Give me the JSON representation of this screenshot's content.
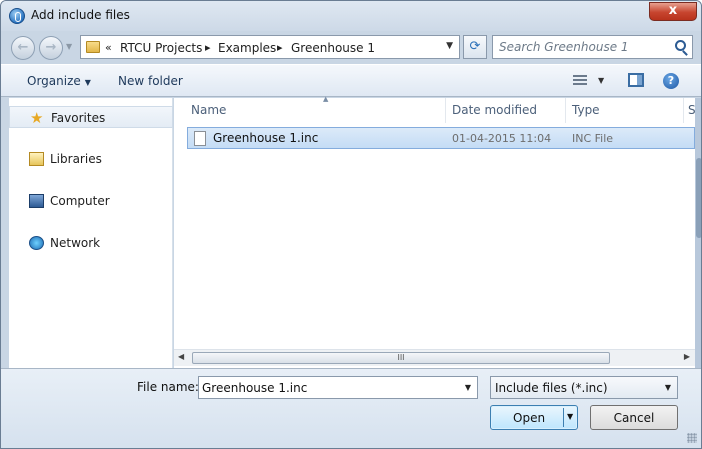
{
  "window": {
    "title": "Add include files",
    "close_label": "x"
  },
  "nav": {
    "back_label": "←",
    "forward_label": "→"
  },
  "address": {
    "overflow": "«",
    "crumbs": [
      "RTCU Projects",
      "Examples",
      "Greenhouse 1"
    ],
    "separator": "▸",
    "dropdown": "▼"
  },
  "search": {
    "placeholder": "Search Greenhouse 1"
  },
  "toolbar": {
    "organize_label": "Organize",
    "new_folder_label": "New folder",
    "help_label": "?"
  },
  "sidebar": {
    "items": [
      {
        "label": "Favorites",
        "icon": "star-icon"
      },
      {
        "label": "Libraries",
        "icon": "libraries-icon"
      },
      {
        "label": "Computer",
        "icon": "computer-icon"
      },
      {
        "label": "Network",
        "icon": "network-icon"
      }
    ]
  },
  "files": {
    "columns": [
      "Name",
      "Date modified",
      "Type",
      "S"
    ],
    "rows": [
      {
        "name": "Greenhouse 1.inc",
        "date": "01-04-2015 11:04",
        "type": "INC File"
      }
    ]
  },
  "scrollbar": {
    "grip": "III"
  },
  "bottom": {
    "file_name_label": "File name:",
    "file_name_value": "Greenhouse 1.inc",
    "filter_value": "Include files (*.inc)",
    "open_label": "Open",
    "cancel_label": "Cancel"
  },
  "colors": {
    "accent": "#3c7fb1",
    "selection": "#c4dcf5",
    "close": "#c7452f"
  }
}
